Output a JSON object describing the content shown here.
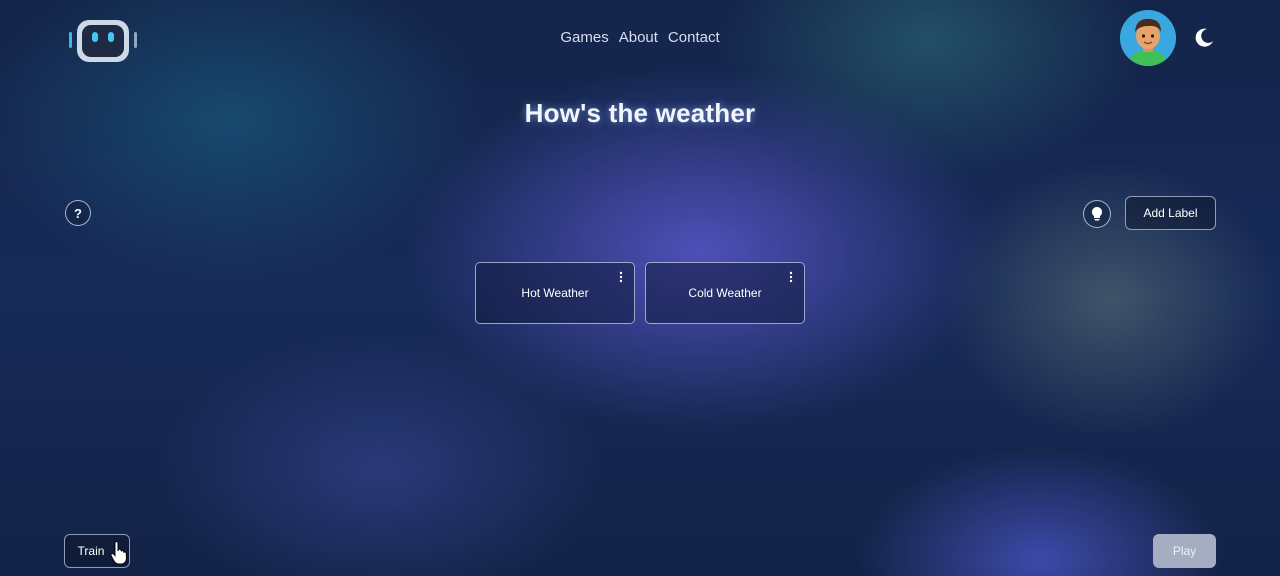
{
  "header": {
    "logo_icon": "robot-face-icon",
    "nav": [
      {
        "label": "Games"
      },
      {
        "label": "About"
      },
      {
        "label": "Contact"
      }
    ],
    "avatar_icon": "user-avatar",
    "theme_toggle_icon": "moon-icon"
  },
  "page": {
    "title": "How's the weather"
  },
  "toolbar": {
    "help_label": "?",
    "hint_icon": "lightbulb-icon",
    "add_label": "Add Label"
  },
  "labels": [
    {
      "name": "Hot Weather",
      "menu_icon": "kebab-menu-icon"
    },
    {
      "name": "Cold Weather",
      "menu_icon": "kebab-menu-icon"
    }
  ],
  "footer": {
    "train_label": "Train",
    "play_label": "Play"
  },
  "colors": {
    "background": "#14254a",
    "accent_glow": "#5856c8",
    "play_disabled": "#a4adc2",
    "avatar_bg": "#3aa7e0"
  }
}
